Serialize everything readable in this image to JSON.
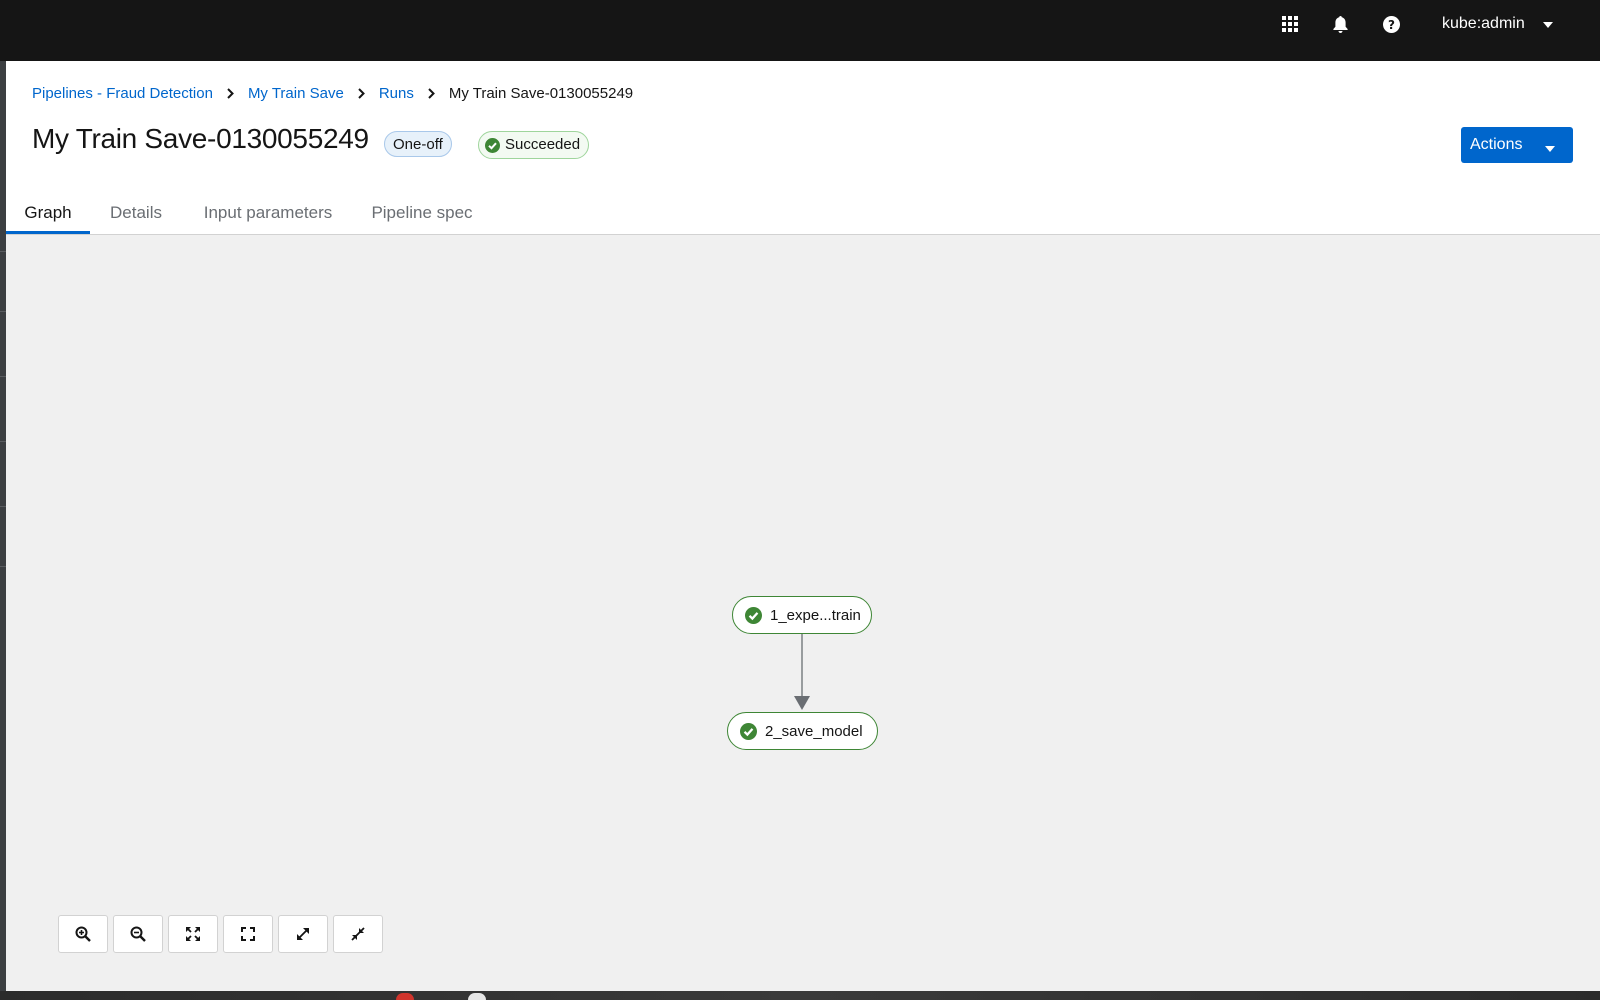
{
  "masthead": {
    "icons": [
      "apps-grid-icon",
      "notification-bell-icon",
      "help-icon"
    ],
    "user": "kube:admin"
  },
  "breadcrumb": {
    "items": [
      "Pipelines - Fraud Detection",
      "My Train Save",
      "Runs"
    ],
    "current": "My Train Save-0130055249"
  },
  "header": {
    "title": "My Train Save-0130055249",
    "run_type_label": "One-off",
    "status_label": "Succeeded",
    "actions_label": "Actions"
  },
  "tabs": [
    {
      "label": "Graph",
      "active": true
    },
    {
      "label": "Details",
      "active": false
    },
    {
      "label": "Input parameters",
      "active": false
    },
    {
      "label": "Pipeline spec",
      "active": false
    }
  ],
  "graph": {
    "nodes": [
      {
        "label": "1_expe...train",
        "status": "succeeded"
      },
      {
        "label": "2_save_model",
        "status": "succeeded"
      }
    ],
    "edges": [
      {
        "from": "1_expe...train",
        "to": "2_save_model"
      }
    ]
  },
  "zoom_controls": [
    "zoom-in-icon",
    "zoom-out-icon",
    "fit-to-screen-icon",
    "fullscreen-icon",
    "expand-icon",
    "collapse-icon"
  ],
  "colors": {
    "masthead_bg": "#151515",
    "link": "#0066cc",
    "primary_button": "#0066cc",
    "success": "#3e8635",
    "canvas_bg": "#f0f0f0"
  }
}
